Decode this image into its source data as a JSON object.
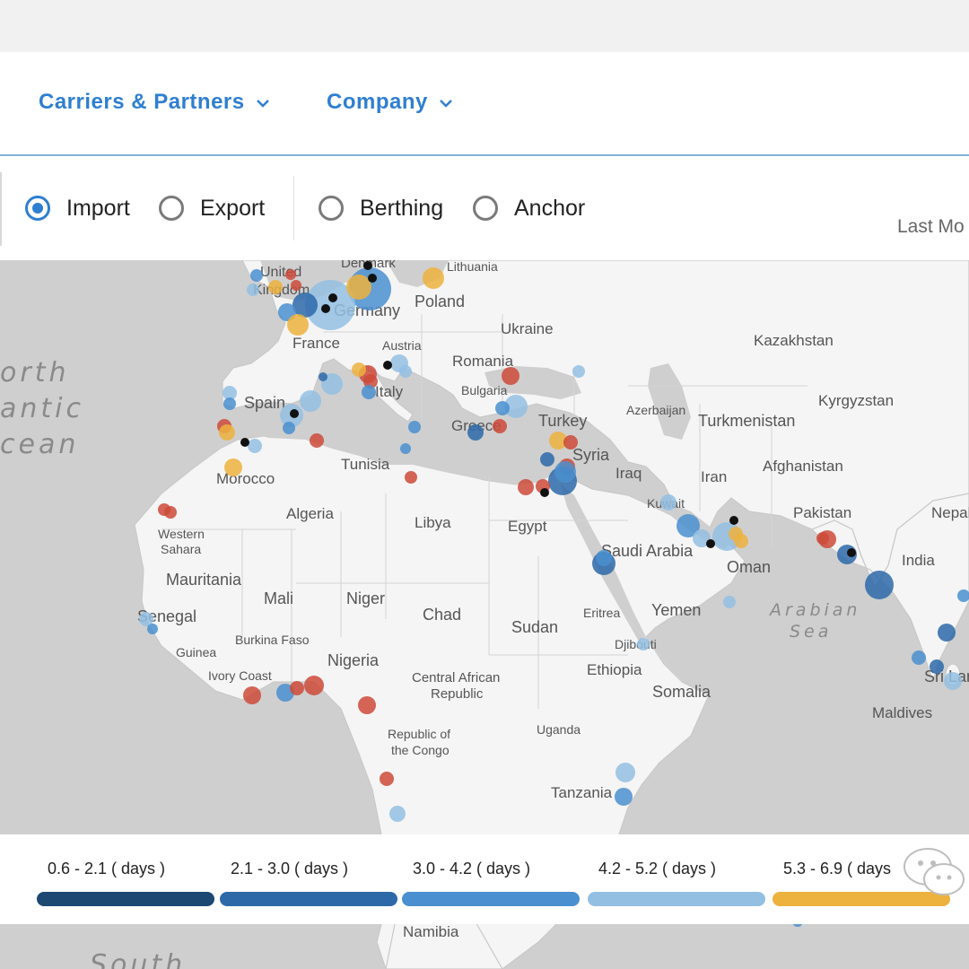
{
  "nav": {
    "items": [
      {
        "label": "Carriers & Partners"
      },
      {
        "label": "Company"
      }
    ]
  },
  "filters": {
    "radios": [
      {
        "label": "Import",
        "checked": true
      },
      {
        "label": "Export",
        "checked": false
      },
      {
        "label": "Berthing",
        "checked": false
      },
      {
        "label": "Anchor",
        "checked": false
      }
    ],
    "period_label": "Last Mo"
  },
  "map": {
    "ocean_labels": [
      "orth",
      "antic",
      "cean",
      "Arabian",
      "Sea",
      "South"
    ],
    "country_labels": [
      "United",
      "Kingdom",
      "Denmark",
      "Lithuania",
      "Poland",
      "Germany",
      "France",
      "Ukraine",
      "Austria",
      "Romania",
      "Kazakhstan",
      "Spain",
      "Italy",
      "Bulgaria",
      "Azerbaijan",
      "Kyrgyzstan",
      "Greece",
      "Turkey",
      "Turkmenistan",
      "Syria",
      "Tunisia",
      "Morocco",
      "Iraq",
      "Iran",
      "Afghanistan",
      "Kuwait",
      "Algeria",
      "Libya",
      "Egypt",
      "Pakistan",
      "Nepal",
      "Western",
      "Sahara",
      "Saudi Arabia",
      "India",
      "Oman",
      "Mauritania",
      "Mali",
      "Niger",
      "Chad",
      "Eritrea",
      "Yemen",
      "Senegal",
      "Sudan",
      "Burkina Faso",
      "Guinea",
      "Djibouti",
      "Nigeria",
      "Ethiopia",
      "Ivory Coast",
      "Central African",
      "Republic",
      "Somalia",
      "Sri Lanka",
      "Maldives",
      "Uganda",
      "Republic of",
      "the Congo",
      "Tanzania",
      "Namibia"
    ],
    "port_color_scale": [
      "#1c4872",
      "#2d69a9",
      "#4a8fcf",
      "#93bfe3",
      "#edb13e",
      "#cc4a3a",
      "#111111"
    ]
  },
  "legend": {
    "items": [
      {
        "label": "0.6 - 2.1 ( days )",
        "color": "#1c4872"
      },
      {
        "label": "2.1 - 3.0 ( days )",
        "color": "#2d69a9"
      },
      {
        "label": "3.0 - 4.2 ( days )",
        "color": "#4a8fcf"
      },
      {
        "label": "4.2 - 5.2 ( days )",
        "color": "#93bfe3"
      },
      {
        "label": "5.3 - 6.9 ( days",
        "color": "#edb13e"
      }
    ]
  }
}
